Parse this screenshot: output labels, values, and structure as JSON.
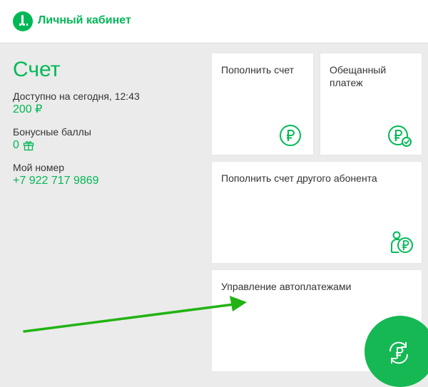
{
  "header": {
    "title": "Личный кабинет",
    "logo_icon": "megafon-logo-icon",
    "brand_color": "#00b956"
  },
  "account": {
    "title": "Счет",
    "available_label": "Доступно на сегодня, 12:43",
    "available_value": "200 ₽",
    "bonus_label": "Бонусные баллы",
    "bonus_value": "0",
    "number_label": "Мой номер",
    "number_value": "+7 922 717 9869"
  },
  "tiles": [
    {
      "label": "Пополнить счет",
      "icon": "ruble-circle-icon"
    },
    {
      "label": "Обещанный платеж",
      "icon": "ruble-check-icon"
    },
    {
      "label": "Пополнить счет другого абонента",
      "icon": "person-ruble-icon"
    },
    {
      "label": "Управление автоплатежами",
      "icon": "autopay-refresh-ruble-icon"
    }
  ],
  "annotation": {
    "arrow_color": "#22b313"
  }
}
